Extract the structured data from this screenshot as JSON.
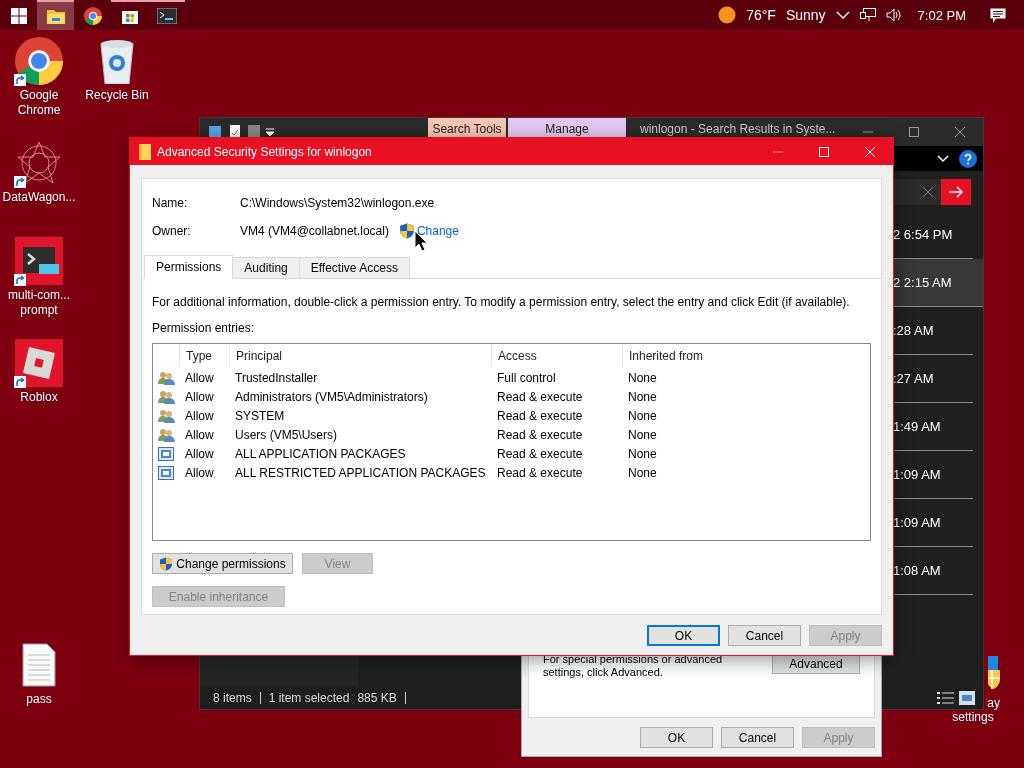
{
  "taskbar": {
    "apps": [
      {
        "kind": "explorer",
        "selected": true,
        "running": true
      },
      {
        "kind": "chrome",
        "selected": false,
        "running": false
      },
      {
        "kind": "store",
        "selected": false,
        "running": true
      },
      {
        "kind": "terminal",
        "selected": false,
        "running": true
      }
    ],
    "weather": {
      "temperature": "76°F",
      "condition": "Sunny"
    },
    "clock": "7:02 PM"
  },
  "desktop_icons": [
    {
      "kind": "chrome",
      "label": "Google Chrome",
      "shortcut": true
    },
    {
      "kind": "recycle",
      "label": "Recycle Bin",
      "shortcut": false
    },
    {
      "kind": "datawagon",
      "label": "DataWagon...",
      "shortcut": true
    },
    {
      "kind": "prompt",
      "label": "multi-com... prompt",
      "shortcut": true
    },
    {
      "kind": "roblox",
      "label": "Roblox",
      "shortcut": true
    },
    {
      "kind": "document",
      "label": "pass",
      "shortcut": false
    },
    {
      "kind": "display",
      "label_lines": [
        "ay",
        "settings"
      ]
    }
  ],
  "explorer_window": {
    "title": "winlogon - Search Results in Syste...",
    "context_tabs": [
      {
        "label": "Search Tools",
        "color": "#f8c7b3"
      },
      {
        "label": "Manage",
        "color": "#e5c8f1"
      }
    ],
    "dates": [
      {
        "text": "2 6:54 PM",
        "selected": false
      },
      {
        "text": "2 2:15 AM",
        "selected": true
      },
      {
        "text": ":28 AM",
        "selected": false
      },
      {
        "text": ":27 AM",
        "selected": false
      },
      {
        "text": "1:49 AM",
        "selected": false
      },
      {
        "text": "1:09 AM",
        "selected": false
      },
      {
        "text": "1:09 AM",
        "selected": false
      },
      {
        "text": "1:08 AM",
        "selected": false
      }
    ],
    "status": {
      "item_count": "8 items",
      "selection": "1 item selected",
      "size": "885 KB"
    }
  },
  "properties_dialog": {
    "note": "For special permissions or advanced settings, click Advanced.",
    "advanced_button": "Advanced",
    "buttons": [
      {
        "label": "OK",
        "disabled": false
      },
      {
        "label": "Cancel",
        "disabled": false
      },
      {
        "label": "Apply",
        "disabled": true
      }
    ]
  },
  "security_dialog": {
    "title": "Advanced Security Settings for winlogon",
    "name_label": "Name:",
    "name": "C:\\Windows\\System32\\winlogon.exe",
    "owner_label": "Owner:",
    "owner": "VM4 (VM4@collabnet.local)",
    "change_link": "Change",
    "tabs": [
      {
        "label": "Permissions",
        "selected": true
      },
      {
        "label": "Auditing",
        "selected": false
      },
      {
        "label": "Effective Access",
        "selected": false
      }
    ],
    "info": "For additional information, double-click a permission entry. To modify a permission entry, select the entry and click Edit (if available).",
    "entries_label": "Permission entries:",
    "columns": [
      "Type",
      "Principal",
      "Access",
      "Inherited from"
    ],
    "rows": [
      {
        "kind": "group",
        "type": "Allow",
        "principal": "TrustedInstaller",
        "access": "Full control",
        "inherited_from": "None"
      },
      {
        "kind": "group",
        "type": "Allow",
        "principal": "Administrators (VM5\\Administrators)",
        "access": "Read & execute",
        "inherited_from": "None"
      },
      {
        "kind": "group",
        "type": "Allow",
        "principal": "SYSTEM",
        "access": "Read & execute",
        "inherited_from": "None"
      },
      {
        "kind": "group",
        "type": "Allow",
        "principal": "Users (VM5\\Users)",
        "access": "Read & execute",
        "inherited_from": "None"
      },
      {
        "kind": "package",
        "type": "Allow",
        "principal": "ALL APPLICATION PACKAGES",
        "access": "Read & execute",
        "inherited_from": "None"
      },
      {
        "kind": "package",
        "type": "Allow",
        "principal": "ALL RESTRICTED APPLICATION PACKAGES",
        "access": "Read & execute",
        "inherited_from": "None"
      }
    ],
    "actions": [
      {
        "label": "Change permissions",
        "shield": true,
        "disabled": false
      },
      {
        "label": "View",
        "shield": false,
        "disabled": true
      },
      {
        "label": "Enable inheritance",
        "shield": false,
        "disabled": true
      }
    ],
    "buttons": [
      {
        "label": "OK",
        "default": true,
        "disabled": false
      },
      {
        "label": "Cancel",
        "default": false,
        "disabled": false
      },
      {
        "label": "Apply",
        "default": false,
        "disabled": true
      }
    ]
  }
}
